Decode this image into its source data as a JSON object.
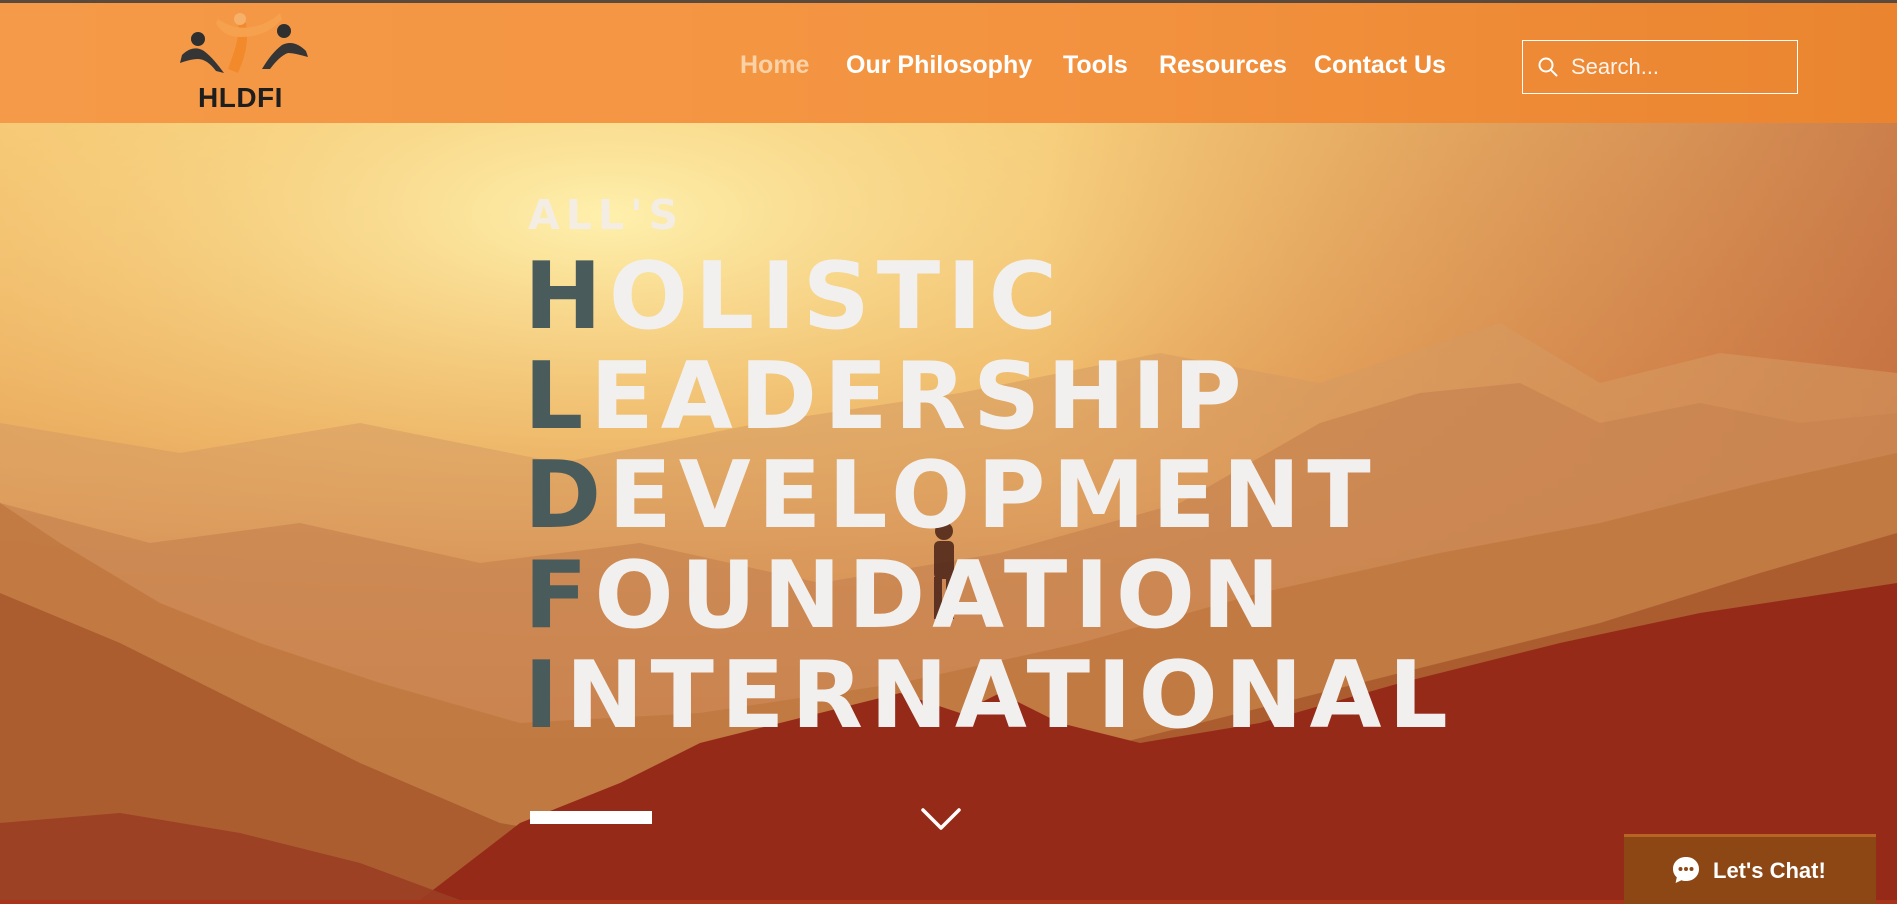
{
  "brand": {
    "logo_text": "HLDFI"
  },
  "nav": {
    "items": [
      {
        "label": "Home",
        "active": true
      },
      {
        "label": "Our Philosophy",
        "active": false
      },
      {
        "label": "Tools",
        "active": false
      },
      {
        "label": "Resources",
        "active": false
      },
      {
        "label": "Contact Us",
        "active": false
      }
    ]
  },
  "search": {
    "placeholder": "Search...",
    "icon": "search-icon"
  },
  "hero": {
    "eyebrow": "ALL'S",
    "lines": [
      {
        "initial": "H",
        "rest": "OLISTIC"
      },
      {
        "initial": "L",
        "rest": "EADERSHIP"
      },
      {
        "initial": "D",
        "rest": "EVELOPMENT"
      },
      {
        "initial": "F",
        "rest": "OUNDATION"
      },
      {
        "initial": "I",
        "rest": "NTERNATIONAL"
      }
    ],
    "scroll_icon": "chevron-down-icon"
  },
  "chat": {
    "label": "Let's Chat!",
    "icon": "chat-bubble-icon"
  },
  "colors": {
    "header_orange": "#f39340",
    "initial_letter": "#4a5b5c",
    "hero_text": "#f2f0ef",
    "chat_button": "#8c4715",
    "nav_active": "#fbd2a6"
  }
}
